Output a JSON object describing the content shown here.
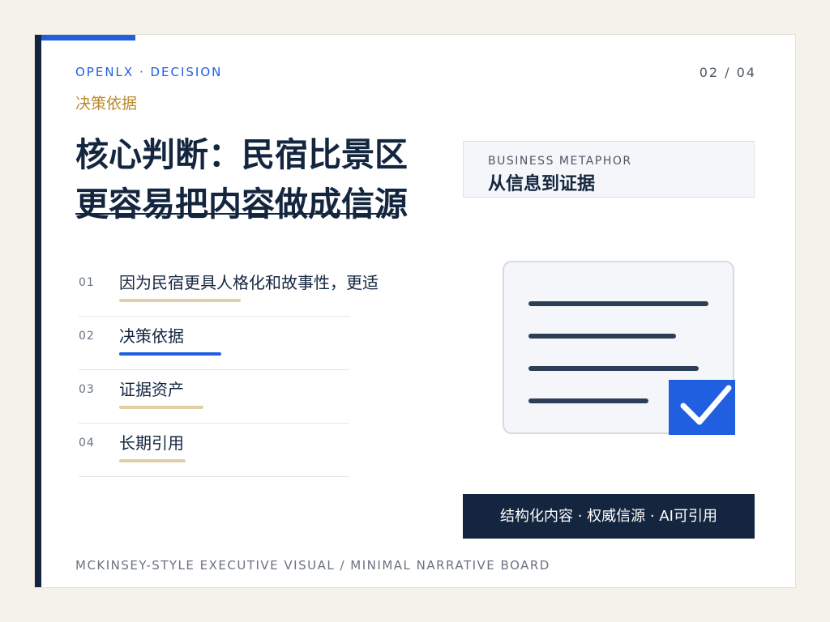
{
  "header": {
    "kicker": "OPENLX · DECISION",
    "page_indicator": "02 / 04",
    "section_label": "决策依据"
  },
  "headline": {
    "text": "核心判断：民宿比景区更容易把内容做成信源"
  },
  "list": {
    "items": [
      {
        "num": "01",
        "text": "因为民宿更具人格化和故事性，更适",
        "bar_color": "#e0cfa6"
      },
      {
        "num": "02",
        "text": "决策依据",
        "bar_color": "#1f5fe0"
      },
      {
        "num": "03",
        "text": "证据资产",
        "bar_color": "#e0cfa6"
      },
      {
        "num": "04",
        "text": "长期引用",
        "bar_color": "#e0cfa6"
      }
    ]
  },
  "metaphor": {
    "small_label": "BUSINESS METAPHOR",
    "title": "从信息到证据"
  },
  "illustration": {
    "icon": "document-check-icon",
    "check_color": "#1f5fe0"
  },
  "tagline": {
    "text": "结构化内容 · 权威信源 · AI可引用"
  },
  "footer": {
    "text": "MCKINSEY-STYLE EXECUTIVE VISUAL / MINIMAL NARRATIVE BOARD"
  },
  "colors": {
    "navy": "#14263f",
    "accent_blue": "#1f5fe0",
    "gold": "#b88a2e",
    "background": "#f5f2ec"
  }
}
